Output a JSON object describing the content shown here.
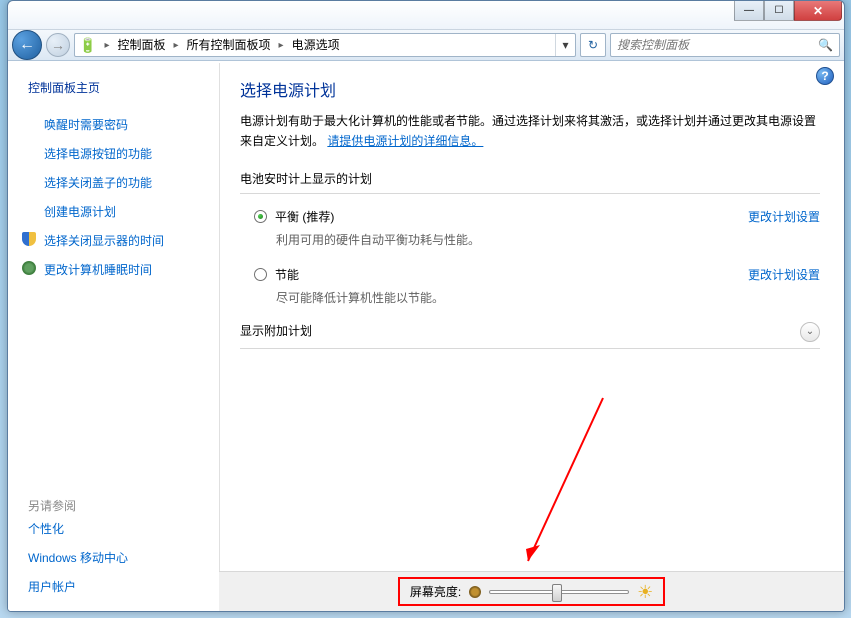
{
  "breadcrumb": {
    "root": "控制面板",
    "mid": "所有控制面板项",
    "leaf": "电源选项"
  },
  "search": {
    "placeholder": "搜索控制面板"
  },
  "sidebar": {
    "title": "控制面板主页",
    "links": [
      "唤醒时需要密码",
      "选择电源按钮的功能",
      "选择关闭盖子的功能",
      "创建电源计划",
      "选择关闭显示器的时间",
      "更改计算机睡眠时间"
    ],
    "see_also_label": "另请参阅",
    "see_also": [
      "个性化",
      "Windows 移动中心",
      "用户帐户"
    ]
  },
  "main": {
    "heading": "选择电源计划",
    "desc_prefix": "电源计划有助于最大化计算机的性能或者节能。通过选择计划来将其激活，或选择计划并通过更改其电源设置来自定义计划。",
    "desc_link": "请提供电源计划的详细信息。",
    "section_label": "电池安时计上显示的计划",
    "plans": [
      {
        "name": "平衡 (推荐)",
        "sub": "利用可用的硬件自动平衡功耗与性能。",
        "checked": true,
        "change": "更改计划设置"
      },
      {
        "name": "节能",
        "sub": "尽可能降低计算机性能以节能。",
        "checked": false,
        "change": "更改计划设置"
      }
    ],
    "additional_label": "显示附加计划"
  },
  "bottom": {
    "brightness_label": "屏幕亮度:"
  }
}
